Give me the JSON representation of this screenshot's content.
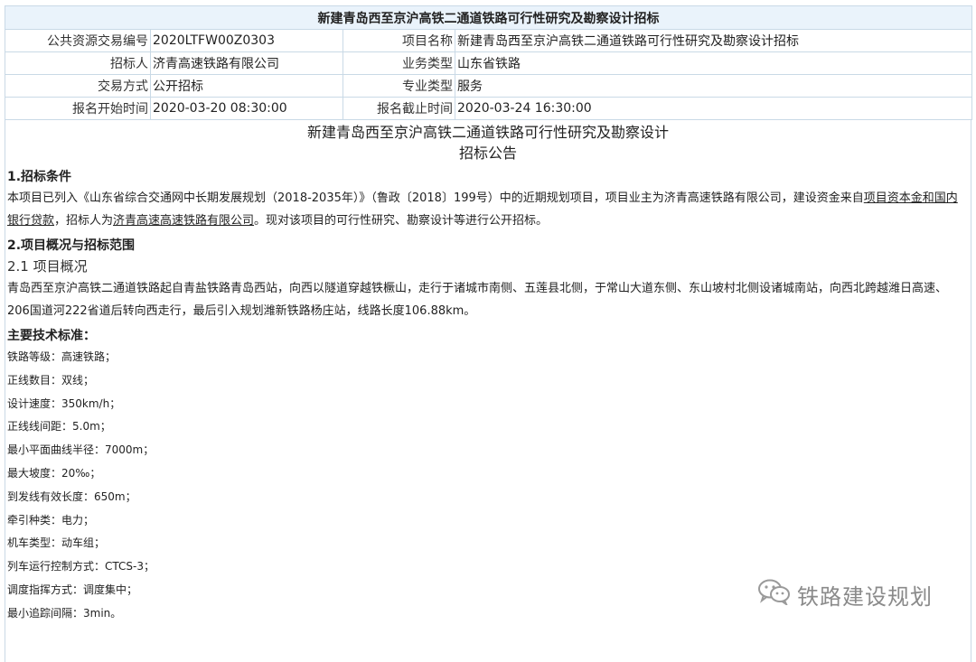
{
  "table": {
    "title": "新建青岛西至京沪高铁二通道铁路可行性研究及勘察设计招标",
    "rows": [
      {
        "k1": "公共资源交易编号",
        "v1": "2020LTFW00Z0303",
        "k2": "项目名称",
        "v2": "新建青岛西至京沪高铁二通道铁路可行性研究及勘察设计招标"
      },
      {
        "k1": "招标人",
        "v1": "济青高速铁路有限公司",
        "k2": "业务类型",
        "v2": "山东省铁路"
      },
      {
        "k1": "交易方式",
        "v1": "公开招标",
        "k2": "专业类型",
        "v2": "服务"
      },
      {
        "k1": "报名开始时间",
        "v1": "2020-03-20 08:30:00",
        "k2": "报名截止时间",
        "v2": "2020-03-24 16:30:00"
      }
    ]
  },
  "doc": {
    "title_line1": "新建青岛西至京沪高铁二通道铁路可行性研究及勘察设计",
    "title_line2": "招标公告",
    "section1": "1.招标条件",
    "para1_a": "本项目已列入《山东省综合交通网中长期发展规划（2018-2035年）》（鲁政〔2018〕199号）中的近期规划项目，项目业主为济青高速铁路有限公司，建设资金来自",
    "para1_u1": "项目资本金和国内银行贷款",
    "para1_b": "，招标人为",
    "para1_u2": "济青高速高速铁路有限公司",
    "para1_c": "。现对该项目的可行性研究、勘察设计等进行公开招标。",
    "section2": "2.项目概况与招标范围",
    "subsection21": "2.1 项目概况",
    "para2": "青岛西至京沪高铁二通道铁路起自青盐铁路青岛西站，向西以隧道穿越铁橛山，走行于诸城市南侧、五莲县北侧，于常山大道东侧、东山坡村北侧设诸城南站，向西北跨越潍日高速、206国道河222省道后转向西走行，最后引入规划潍新铁路杨庄站，线路长度106.88km。",
    "standards_label": "主要技术标准：",
    "standards": [
      "铁路等级：高速铁路；",
      "正线数目：双线；",
      "设计速度：350km/h；",
      "正线线间距：5.0m；",
      "最小平面曲线半径：7000m；",
      "最大坡度：20‰；",
      "到发线有效长度：650m；",
      "牵引种类：电力；",
      "机车类型：动车组；",
      "列车运行控制方式：CTCS-3；",
      "调度指挥方式：调度集中；",
      "最小追踪间隔：3min。"
    ]
  },
  "watermark": {
    "text": "铁路建设规划",
    "icon": "wechat-icon"
  }
}
